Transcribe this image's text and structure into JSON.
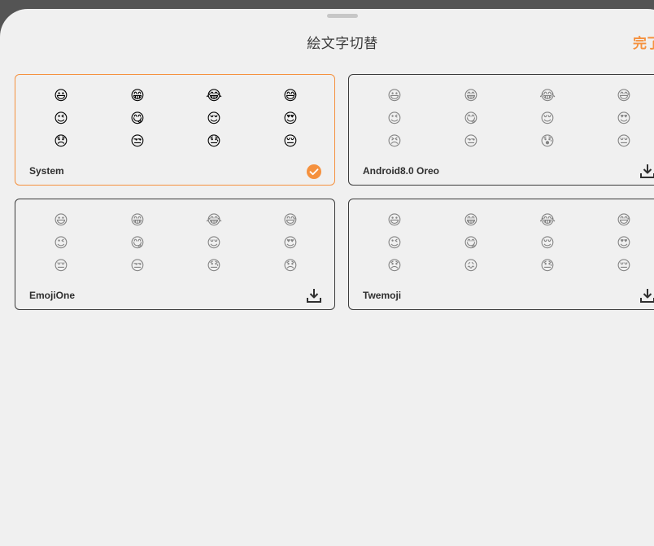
{
  "header": {
    "title": "絵文字切替",
    "done_label": "完了"
  },
  "colors": {
    "accent": "#f5913e",
    "border": "#3b3b3b",
    "background": "#f0f0f0"
  },
  "cards": [
    {
      "name": "System",
      "selected": true,
      "action_icon": "check-circle-icon",
      "emojis": [
        "😃",
        "😁",
        "😂",
        "😅",
        "😉",
        "😋",
        "😌",
        "😍",
        "😞",
        "😒",
        "😓",
        "😔"
      ]
    },
    {
      "name": "Android8.0 Oreo",
      "selected": false,
      "action_icon": "download-icon",
      "emojis": [
        "😃",
        "😁",
        "😂",
        "😅",
        "😉",
        "😋",
        "😌",
        "😍",
        "😣",
        "😒",
        "😰",
        "😔"
      ]
    },
    {
      "name": "EmojiOne",
      "selected": false,
      "action_icon": "download-icon",
      "emojis": [
        "😃",
        "😁",
        "😂",
        "😅",
        "😉",
        "😋",
        "😌",
        "😍",
        "😔",
        "😒",
        "😓",
        "😞"
      ]
    },
    {
      "name": "Twemoji",
      "selected": false,
      "action_icon": "download-icon",
      "emojis": [
        "😃",
        "😁",
        "😂",
        "😅",
        "😉",
        "😋",
        "😌",
        "😍",
        "😞",
        "😖",
        "😓",
        "😔"
      ]
    }
  ]
}
